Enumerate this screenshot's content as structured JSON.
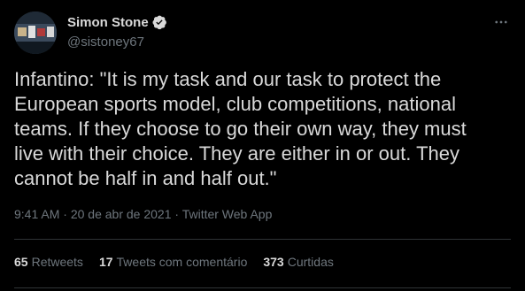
{
  "author": {
    "display_name": "Simon Stone",
    "handle": "@sistoney67",
    "verified": true,
    "verified_color": "#d9d9d9"
  },
  "menu_icon": "more-horizontal-icon",
  "tweet": {
    "text": "Infantino: \"It is my task and our task to protect the\nEuropean sports model, club competitions, national\nteams. If they choose to go their own way, they must\nlive with their choice. They are either in or out. They\ncannot be half in and half out.\"",
    "time": "9:41 AM",
    "separator": "·",
    "date": "20 de abr de 2021",
    "source": "Twitter Web App"
  },
  "stats": {
    "retweets_count": "65",
    "retweets_label": "Retweets",
    "quotes_count": "17",
    "quotes_label": "Tweets com comentário",
    "likes_count": "373",
    "likes_label": "Curtidas"
  },
  "colors": {
    "background": "#000000",
    "text": "#d9d9d9",
    "muted": "#6e767d",
    "divider": "#2f3336"
  }
}
